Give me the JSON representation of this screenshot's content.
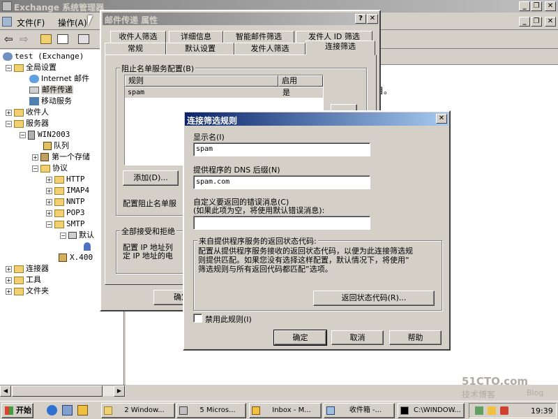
{
  "main_window": {
    "title": "Exchange 系统管理器",
    "menu": [
      "文件(F)",
      "操作(A)"
    ],
    "right_pane_text": "目。"
  },
  "tree": {
    "root": "test (Exchange)",
    "items": [
      "全局设置",
      "Internet 邮件",
      "邮件传递",
      "移动服务",
      "收件人",
      "服务器",
      "WIN2003",
      "队列",
      "第一个存储",
      "协议",
      "HTTP",
      "IMAP4",
      "NNTP",
      "POP3",
      "SMTP",
      "默认",
      "X.400",
      "连接器",
      "工具",
      "文件夹"
    ]
  },
  "props_dialog": {
    "title": "邮件传递 属性",
    "tabs_back": [
      "收件人筛选",
      "详细信息",
      "智能邮件筛选",
      "发件人 ID 筛选"
    ],
    "tabs_front": [
      "常规",
      "默认设置",
      "发件人筛选",
      "连接筛选"
    ],
    "block_group_label": "阻止名单服务配置(B)",
    "list_headers": [
      "规则",
      "启用"
    ],
    "list_rows": [
      {
        "rule": "spam",
        "enabled": "是"
      }
    ],
    "add_button": "添加(D)...",
    "config_block_text": "配置阻止名单服",
    "accept_group_label": "全部接受和拒绝",
    "accept_text_1": "配置 IP 地址列",
    "accept_text_2": "定 IP 地址的电",
    "ok_button": "确定"
  },
  "rule_dialog": {
    "title": "连接筛选规则",
    "display_name_label": "显示名(I)",
    "display_name_value": "spam",
    "dns_suffix_label": "提供程序的 DNS 后缀(N)",
    "dns_suffix_value": "spam.com",
    "custom_error_label": "自定义要返回的错误消息(C)",
    "custom_error_hint": "(如果此项为空，将使用默认错误消息):",
    "custom_error_value": "",
    "return_group_label": "来自提供程序服务的返回状态代码:",
    "return_desc_1": "配置从提供程序服务接收的返回状态代码，以便为此连接筛选规",
    "return_desc_2": "则提供匹配。如果您没有选择这样配置，默认情况下，将使用“",
    "return_desc_3": "筛选规则与所有返回代码都匹配”选项。",
    "return_code_button": "返回状态代码(R)...",
    "disable_rule_label": "禁用此规则(I)",
    "ok": "确定",
    "cancel": "取消",
    "help": "帮助"
  },
  "taskbar": {
    "start": "开始",
    "buttons": [
      "2 Window...",
      "5 Micros...",
      "Inbox - M...",
      "收件箱 -...",
      "C:\\WINDOW..."
    ],
    "clock": "19:39"
  },
  "watermark": {
    "line1": "51CTO.com",
    "line2": "技术博客",
    "line3": "Blog"
  }
}
